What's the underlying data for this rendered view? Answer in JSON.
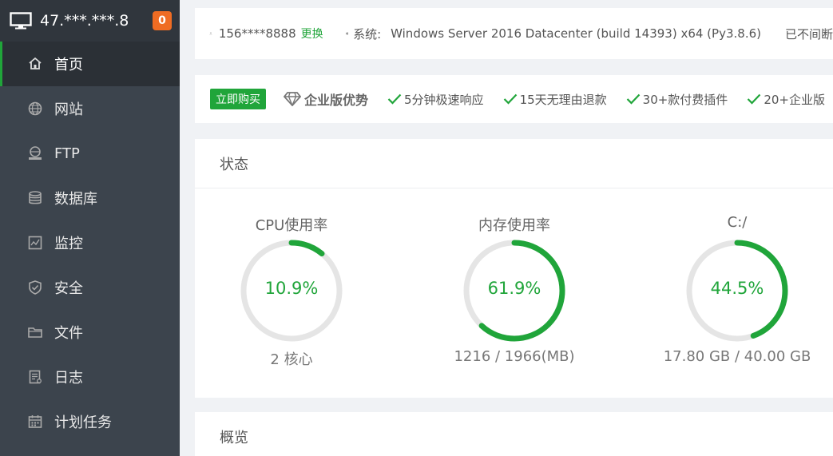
{
  "sidebar": {
    "ip": "47.***.***.8",
    "badge": "0",
    "items": [
      {
        "label": "首页",
        "icon": "home-icon"
      },
      {
        "label": "网站",
        "icon": "globe-icon"
      },
      {
        "label": "FTP",
        "icon": "ftp-icon"
      },
      {
        "label": "数据库",
        "icon": "database-icon"
      },
      {
        "label": "监控",
        "icon": "monitor-chart-icon"
      },
      {
        "label": "安全",
        "icon": "shield-icon"
      },
      {
        "label": "文件",
        "icon": "folder-icon"
      },
      {
        "label": "日志",
        "icon": "log-icon"
      },
      {
        "label": "计划任务",
        "icon": "calendar-icon"
      }
    ]
  },
  "topbar": {
    "phone": "156****8888",
    "change": "更换",
    "sys_label": "系统:",
    "sys_value": "Windows Server 2016 Datacenter (build 14393) x64 (Py3.8.6)",
    "uptime_partial": "已不间断"
  },
  "promo": {
    "buy": "立即购买",
    "enterprise": "企业版优势",
    "features": [
      "5分钟极速响应",
      "15天无理由退款",
      "30+款付费插件",
      "20+企业版"
    ]
  },
  "status": {
    "title": "状态",
    "gauges": [
      {
        "title": "CPU使用率",
        "value": "10.9%",
        "percent": 10.9,
        "sub": "2 核心"
      },
      {
        "title": "内存使用率",
        "value": "61.9%",
        "percent": 61.9,
        "sub": "1216 / 1966(MB)"
      },
      {
        "title": "C:/",
        "value": "44.5%",
        "percent": 44.5,
        "sub": "17.80 GB / 40.00 GB"
      }
    ]
  },
  "overview": {
    "title": "概览"
  },
  "colors": {
    "accent": "#20a53a",
    "badge": "#ef6c23",
    "track": "#e5e5e5"
  }
}
